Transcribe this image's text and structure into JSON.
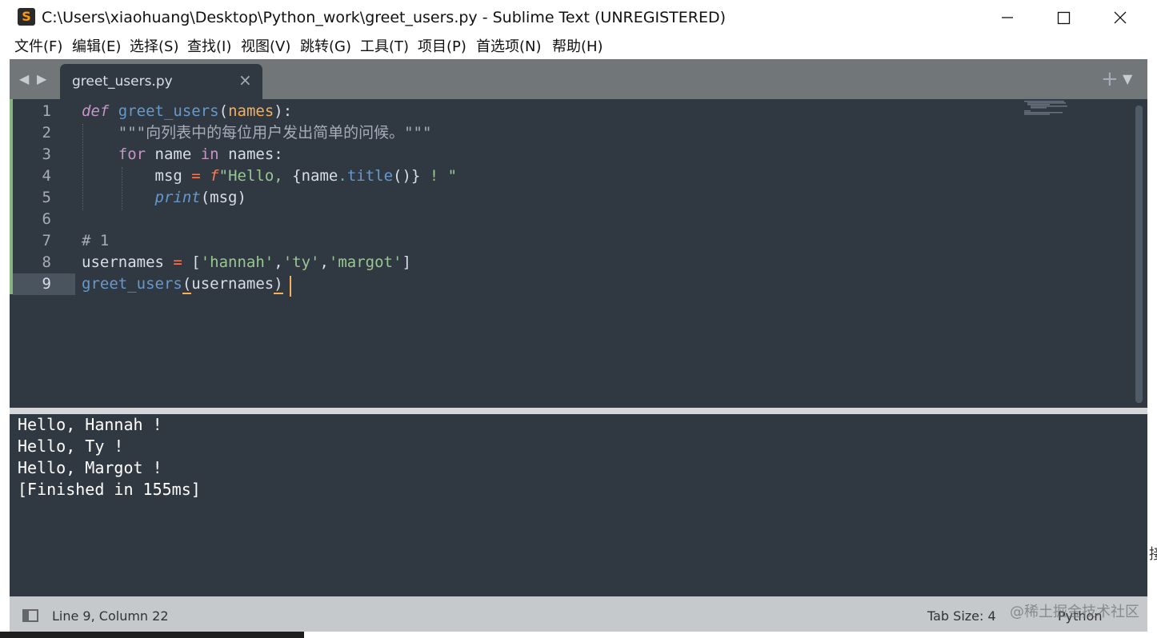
{
  "window": {
    "title": "C:\\Users\\xiaohuang\\Desktop\\Python_work\\greet_users.py - Sublime Text (UNREGISTERED)"
  },
  "menu": [
    "文件(F)",
    "编辑(E)",
    "选择(S)",
    "查找(I)",
    "视图(V)",
    "跳转(G)",
    "工具(T)",
    "项目(P)",
    "首选项(N)",
    "帮助(H)"
  ],
  "tab": {
    "label": "greet_users.py",
    "close": "×"
  },
  "tabstrip": {
    "prev": "◀",
    "next": "▶",
    "new_tab": "+",
    "dropdown": "▼"
  },
  "editor": {
    "line_numbers": [
      "1",
      "2",
      "3",
      "4",
      "5",
      "6",
      "7",
      "8",
      "9"
    ],
    "code": {
      "l1": {
        "kw": "def",
        "fn": "greet_users",
        "open": "(",
        "param": "names",
        "close": "):"
      },
      "l2": {
        "indent": "    ",
        "q1": "\"\"\"",
        "text": "向列表中的每位用户发出简单的问候。",
        "q2": "\"\"\""
      },
      "l3": {
        "indent": "    ",
        "kw": "for",
        "mid1": " name ",
        "in": "in",
        "mid2": " names:"
      },
      "l4": {
        "indent": "        ",
        "var": "msg",
        "eq": " = ",
        "f": "f",
        "s1": "\"Hello, ",
        "lb": "{",
        "expr": "name",
        "dot": ".",
        "meth": "title",
        "call": "()",
        "rb": "}",
        "s2": " ! \""
      },
      "l5": {
        "indent": "        ",
        "bi": "print",
        "rest": "(msg)"
      },
      "l7": {
        "comment": "# 1"
      },
      "l8": {
        "var": "usernames",
        "eq": " = ",
        "lb": "[",
        "s1": "'hannah'",
        "c1": ",",
        "s2": "'ty'",
        "c2": ",",
        "s3": "'margot'",
        "rb": "]"
      },
      "l9": {
        "fn": "greet_users",
        "open": "(",
        "arg": "usernames",
        "close": ")"
      }
    }
  },
  "console": {
    "lines": [
      "Hello, Hannah !",
      "Hello, Ty !",
      "Hello, Margot !",
      "[Finished in 155ms]"
    ]
  },
  "status": {
    "position": "Line 9, Column 22",
    "tab_size": "Tab Size: 4",
    "syntax": "Python",
    "watermark": "@稀土掘金技术社区"
  },
  "edge_glyph": "接",
  "colors": {
    "editor_bg": "#303841",
    "keyword": "#c695c6",
    "function": "#6699cc",
    "string": "#99c794",
    "parameter": "#f9ae58",
    "operator": "#f97b58"
  }
}
